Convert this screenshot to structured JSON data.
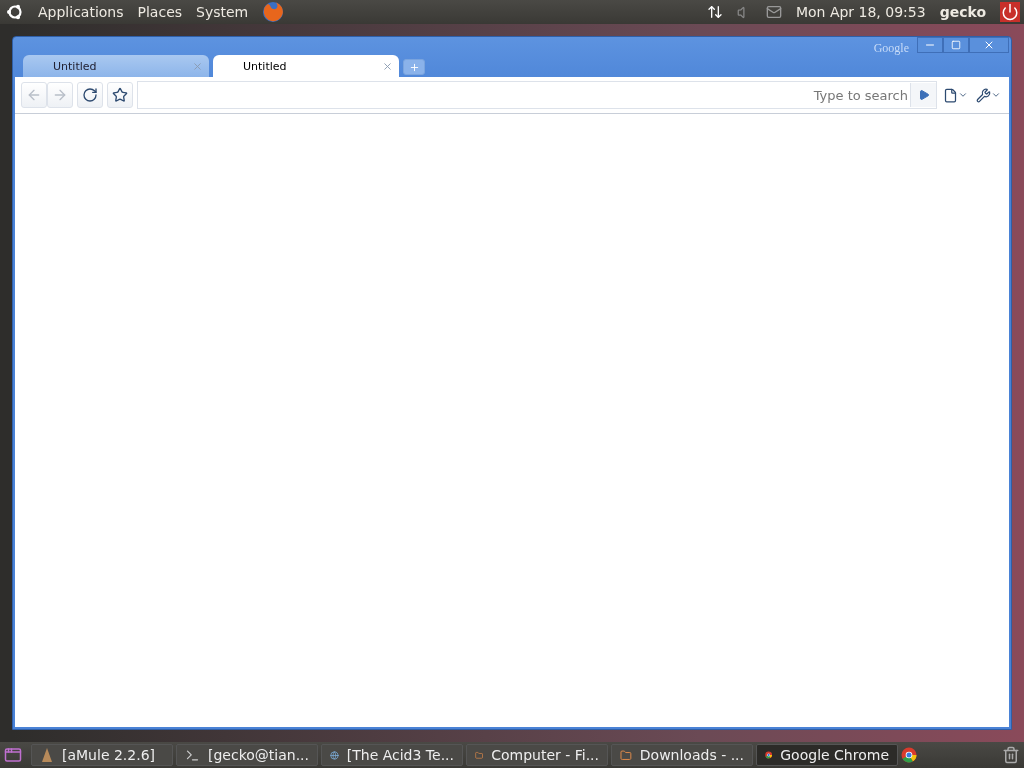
{
  "top_panel": {
    "menus": [
      "Applications",
      "Places",
      "System"
    ],
    "clock": "Mon Apr 18, 09:53",
    "user": "gecko"
  },
  "browser": {
    "logo": "Google",
    "tabs": [
      {
        "label": "Untitled",
        "selected": false
      },
      {
        "label": "Untitled",
        "selected": true
      }
    ],
    "back": {
      "disabled": true
    },
    "forward": {
      "disabled": true
    },
    "address_bar": {
      "placeholder": "Type to search"
    }
  },
  "taskbar": {
    "items": [
      {
        "kind": "amule",
        "label": "[aMule 2.2.6]",
        "selected": false
      },
      {
        "kind": "terminal",
        "label": "[gecko@tian...",
        "selected": false
      },
      {
        "kind": "globe",
        "label": "[The Acid3 Te...",
        "selected": false
      },
      {
        "kind": "folder",
        "label": "Computer - Fi...",
        "selected": false
      },
      {
        "kind": "folder",
        "label": "Downloads - ...",
        "selected": false
      },
      {
        "kind": "chrome",
        "label": "Google Chrome",
        "selected": true
      }
    ]
  }
}
